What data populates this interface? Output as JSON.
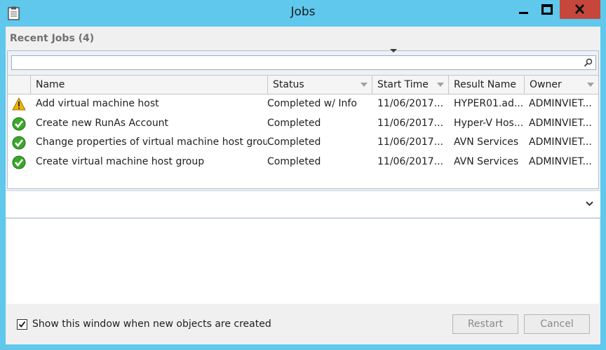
{
  "window": {
    "title": "Jobs",
    "icon": "clipboard-icon",
    "controls": [
      "minimize-icon",
      "maximize-icon",
      "close-icon"
    ]
  },
  "recent": {
    "label": "Recent Jobs (4)"
  },
  "search": {
    "value": "",
    "placeholder": "",
    "icon": "search-icon"
  },
  "columns": {
    "name": "Name",
    "status": "Status",
    "start_time": "Start Time",
    "result_name": "Result Name",
    "owner": "Owner"
  },
  "jobs": [
    {
      "icon": "warning-icon",
      "name": "Add virtual machine host",
      "status": "Completed w/ Info",
      "start_time": "11/06/2017...",
      "result_name": "HYPER01.ad...",
      "owner": "ADMINVIET..."
    },
    {
      "icon": "success-check-icon",
      "name": "Create new RunAs Account",
      "status": "Completed",
      "start_time": "11/06/2017...",
      "result_name": "Hyper-V Hos...",
      "owner": "ADMINVIET..."
    },
    {
      "icon": "success-check-icon",
      "name": "Change properties of virtual machine host group",
      "status": "Completed",
      "start_time": "11/06/2017...",
      "result_name": "AVN Services",
      "owner": "ADMINVIET..."
    },
    {
      "icon": "success-check-icon",
      "name": "Create virtual machine host group",
      "status": "Completed",
      "start_time": "11/06/2017...",
      "result_name": "AVN Services",
      "owner": "ADMINVIET..."
    }
  ],
  "footer": {
    "show_window_label": "Show this window when new objects are created",
    "show_window_checked": true,
    "restart_label": "Restart",
    "cancel_label": "Cancel"
  },
  "colors": {
    "frame": "#5fc8ec",
    "close_button": "#c7463b",
    "success": "#3aa82a",
    "warning": "#f0b400"
  }
}
